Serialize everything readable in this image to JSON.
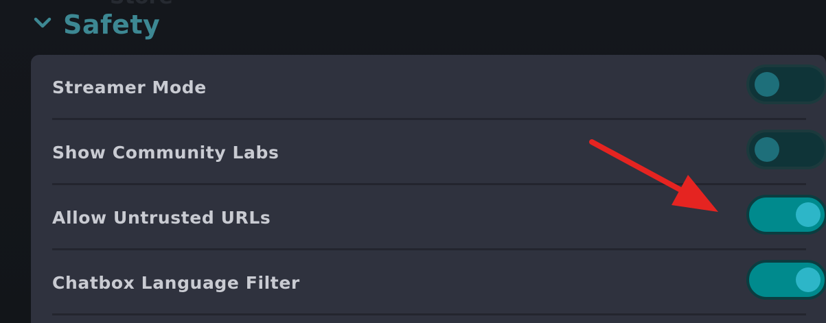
{
  "background_text": "Store",
  "section": {
    "title": "Safety",
    "expanded": true,
    "icon": "chevron-down-icon"
  },
  "settings": [
    {
      "label": "Streamer Mode",
      "enabled": false
    },
    {
      "label": "Show Community Labs",
      "enabled": false
    },
    {
      "label": "Allow Untrusted URLs",
      "enabled": true
    },
    {
      "label": "Chatbox Language Filter",
      "enabled": true
    }
  ],
  "colors": {
    "accent": "#3d8893",
    "toggle_on": "#008a8d",
    "toggle_off": "#0f3438",
    "annotation_arrow": "#e52421"
  },
  "annotation": {
    "type": "arrow",
    "points_to": "Allow Untrusted URLs toggle"
  }
}
